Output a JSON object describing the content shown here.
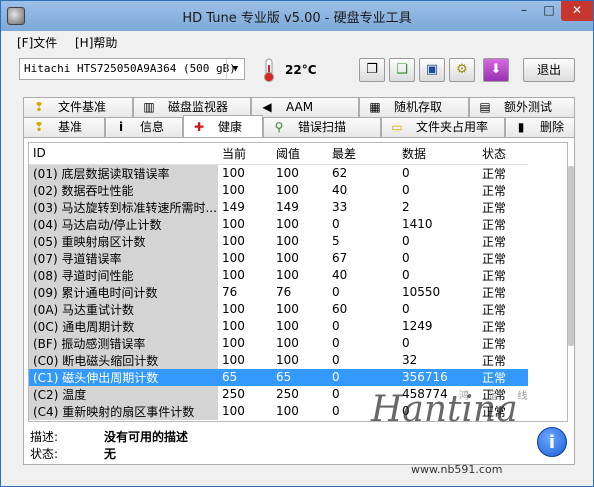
{
  "window": {
    "title": "HD Tune 专业版 v5.00 - 硬盘专业工具",
    "minimize": "–",
    "maximize": "□",
    "close": "✕"
  },
  "menu": {
    "file": "[F]文件",
    "help": "[H]帮助"
  },
  "toolbar": {
    "drive": "Hitachi HTS725050A9A364 (500 gB)",
    "temperature": "22°C",
    "exit_label": "退出",
    "icons": [
      "copy-icon",
      "copy-all-icon",
      "save-icon",
      "settings-icon",
      "download-icon"
    ]
  },
  "tabs_row1": [
    {
      "label": "文件基准",
      "icon": "file-benchmark-icon"
    },
    {
      "label": "磁盘监视器",
      "icon": "disk-monitor-icon"
    },
    {
      "label": "AAM",
      "icon": "speaker-icon"
    },
    {
      "label": "随机存取",
      "icon": "random-access-icon"
    },
    {
      "label": "额外测试",
      "icon": "extra-tests-icon"
    }
  ],
  "tabs_row2": [
    {
      "label": "基准",
      "icon": "benchmark-icon"
    },
    {
      "label": "信息",
      "icon": "info-icon"
    },
    {
      "label": "健康",
      "icon": "health-icon",
      "active": true
    },
    {
      "label": "错误扫描",
      "icon": "error-scan-icon"
    },
    {
      "label": "文件夹占用率",
      "icon": "folder-usage-icon"
    },
    {
      "label": "删除",
      "icon": "erase-icon"
    }
  ],
  "table": {
    "headers": [
      "ID",
      "当前",
      "阈值",
      "最差",
      "数据",
      "状态"
    ],
    "rows": [
      [
        "(01) 底层数据读取错误率",
        "100",
        "100",
        "62",
        "0",
        "正常"
      ],
      [
        "(02) 数据吞吐性能",
        "100",
        "100",
        "40",
        "0",
        "正常"
      ],
      [
        "(03) 马达旋转到标准转速所需时...",
        "149",
        "149",
        "33",
        "2",
        "正常"
      ],
      [
        "(04) 马达启动/停止计数",
        "100",
        "100",
        "0",
        "1410",
        "正常"
      ],
      [
        "(05) 重映射扇区计数",
        "100",
        "100",
        "5",
        "0",
        "正常"
      ],
      [
        "(07) 寻道错误率",
        "100",
        "100",
        "67",
        "0",
        "正常"
      ],
      [
        "(08) 寻道时间性能",
        "100",
        "100",
        "40",
        "0",
        "正常"
      ],
      [
        "(09) 累计通电时间计数",
        "76",
        "76",
        "0",
        "10550",
        "正常"
      ],
      [
        "(0A) 马达重试计数",
        "100",
        "100",
        "60",
        "0",
        "正常"
      ],
      [
        "(0C) 通电周期计数",
        "100",
        "100",
        "0",
        "1249",
        "正常"
      ],
      [
        "(BF) 振动感测错误率",
        "100",
        "100",
        "0",
        "0",
        "正常"
      ],
      [
        "(C0) 断电磁头缩回计数",
        "100",
        "100",
        "0",
        "32",
        "正常"
      ],
      [
        "(C1) 磁头伸出周期计数",
        "65",
        "65",
        "0",
        "356716",
        "正常"
      ],
      [
        "(C2) 温度",
        "250",
        "250",
        "0",
        "458774",
        "正常"
      ],
      [
        "(C4) 重新映射的扇区事件计数",
        "100",
        "100",
        "0",
        "0",
        "正常"
      ]
    ],
    "selected_row": 12
  },
  "details": {
    "desc_label": "描述:",
    "desc_value": "没有可用的描述",
    "status_label": "状态:",
    "status_value": "无"
  },
  "watermark": {
    "script_text": "Hantina",
    "chinese": "鸿 运 线",
    "url": "www.nb591.com",
    "badge": "i"
  }
}
